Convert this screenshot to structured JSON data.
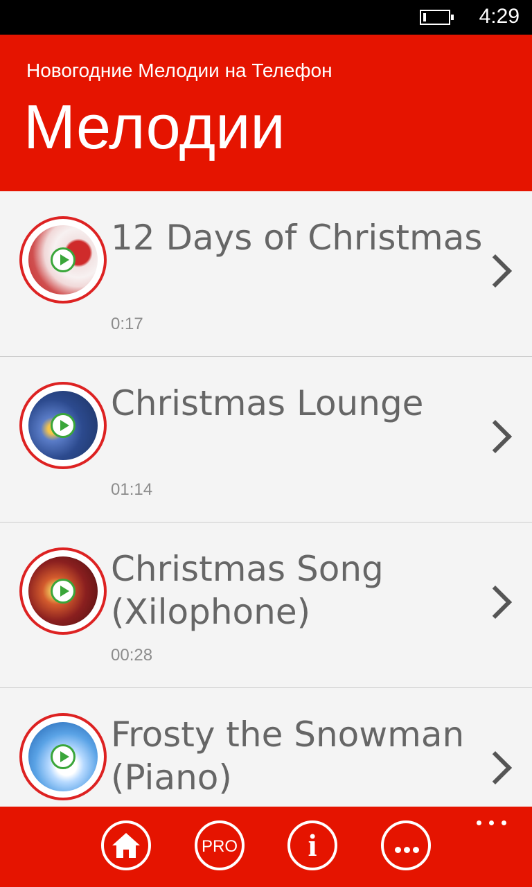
{
  "status_bar": {
    "time": "4:29"
  },
  "header": {
    "app_title": "Новогодние Мелодии на Телефон",
    "page_title": "Мелодии"
  },
  "songs": [
    {
      "title": "12 Days of Christmas",
      "duration": "0:17"
    },
    {
      "title": "Christmas Lounge",
      "duration": "01:14"
    },
    {
      "title": "Christmas Song (Xilophone)",
      "duration": "00:28"
    },
    {
      "title": "Frosty the Snowman (Piano)",
      "duration": ""
    }
  ],
  "app_bar": {
    "pro_label": "PRO",
    "info_label": "i"
  },
  "colors": {
    "accent": "#e51400",
    "play": "#3aa63a"
  }
}
